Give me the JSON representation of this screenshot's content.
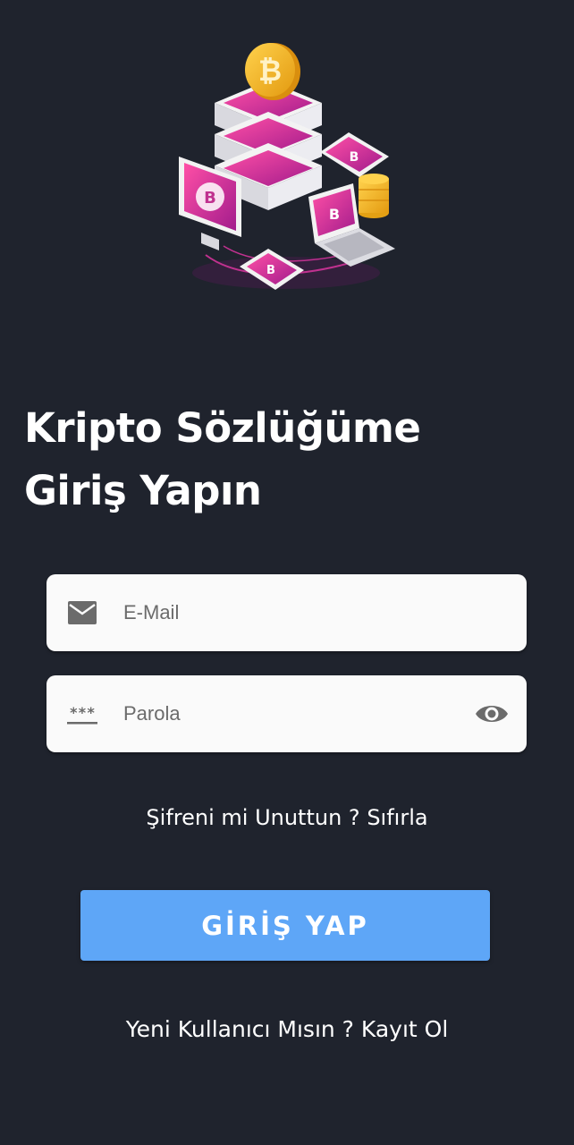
{
  "login": {
    "title_line1": "Kripto Sözlüğüme",
    "title_line2": "Giriş Yapın",
    "email_placeholder": "E-Mail",
    "password_placeholder": "Parola",
    "password_mask_glyph": "***",
    "forgot_prompt": "Şifreni mi Unuttun ?",
    "forgot_link": "Sıfırla",
    "login_button": "GİRİŞ YAP",
    "register_prompt": "Yeni Kullanıcı Mısın ?",
    "register_link": "Kayıt Ol"
  },
  "icons": {
    "email": "mail-icon",
    "password": "password-dots-icon",
    "toggle": "eye-icon",
    "hero": "crypto-illustration"
  },
  "colors": {
    "background": "#1f232d",
    "field_bg": "#fafafa",
    "button_bg": "#5ea6f7",
    "accent_pink": "#e8379a",
    "coin_gold": "#f5b820"
  }
}
